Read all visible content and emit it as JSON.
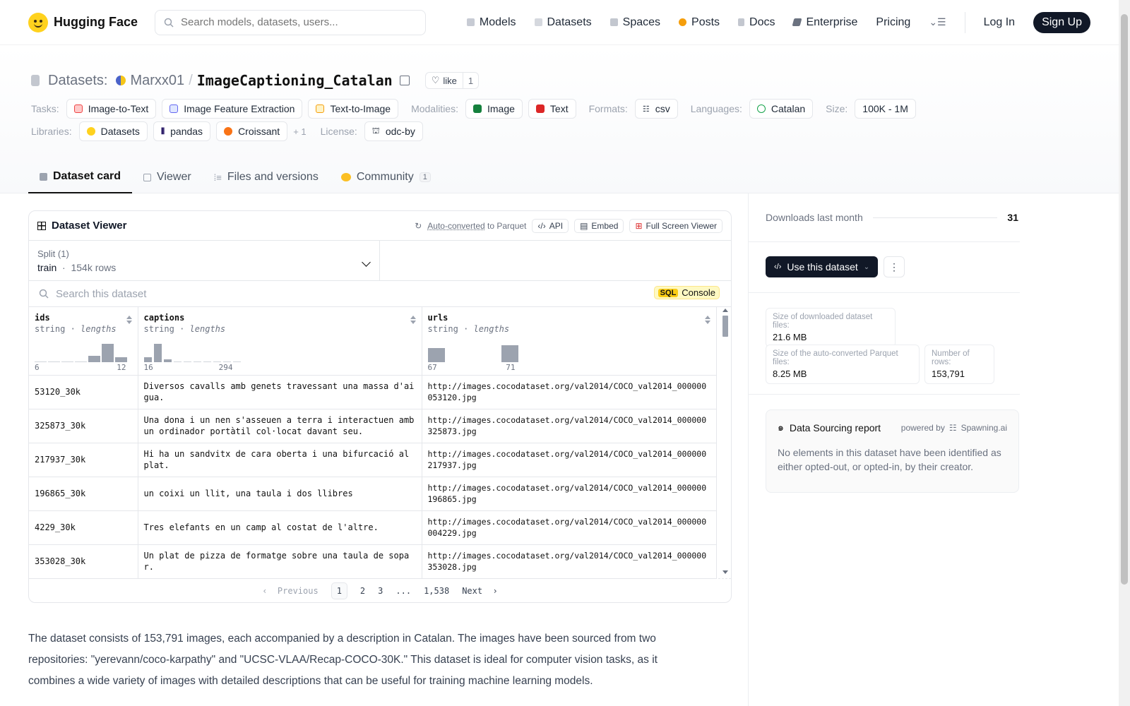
{
  "nav": {
    "brand": "Hugging Face",
    "search_placeholder": "Search models, datasets, users...",
    "links": [
      "Models",
      "Datasets",
      "Spaces",
      "Posts",
      "Docs",
      "Enterprise",
      "Pricing"
    ],
    "login": "Log In",
    "signup": "Sign Up"
  },
  "header": {
    "section": "Datasets:",
    "owner": "Marxx01",
    "separator": "/",
    "name": "ImageCaptioning_Catalan",
    "like_label": "like",
    "like_count": "1",
    "tasks_label": "Tasks:",
    "tasks": [
      "Image-to-Text",
      "Image Feature Extraction",
      "Text-to-Image"
    ],
    "modalities_label": "Modalities:",
    "modalities": [
      "Image",
      "Text"
    ],
    "formats_label": "Formats:",
    "formats": [
      "csv"
    ],
    "languages_label": "Languages:",
    "languages": [
      "Catalan"
    ],
    "size_label": "Size:",
    "size": "100K - 1M",
    "libraries_label": "Libraries:",
    "libraries": [
      "Datasets",
      "pandas",
      "Croissant"
    ],
    "libraries_more": "+ 1",
    "license_label": "License:",
    "license": "odc-by"
  },
  "tabs": [
    {
      "label": "Dataset card"
    },
    {
      "label": "Viewer"
    },
    {
      "label": "Files and versions"
    },
    {
      "label": "Community",
      "badge": "1"
    }
  ],
  "viewer": {
    "title": "Dataset Viewer",
    "auto_converted": "Auto-converted",
    "to_parquet": "to Parquet",
    "api": "API",
    "embed": "Embed",
    "full_screen": "Full Screen Viewer",
    "split_label": "Split (1)",
    "split_name": "train",
    "split_rows": "154k rows",
    "search_placeholder": "Search this dataset",
    "sql": "SQL",
    "console": "Console",
    "columns": [
      {
        "name": "ids",
        "type": "string",
        "stat": "lengths",
        "min": "6",
        "max": "12"
      },
      {
        "name": "captions",
        "type": "string",
        "stat": "lengths",
        "min": "16",
        "max": "294"
      },
      {
        "name": "urls",
        "type": "string",
        "stat": "lengths",
        "min": "67",
        "max": "71"
      }
    ],
    "rows": [
      [
        "53120_30k",
        "Diversos cavalls amb genets travessant una massa d'aigua.",
        "http://images.cocodataset.org/val2014/COCO_val2014_000000053120.jpg"
      ],
      [
        "325873_30k",
        "Una dona i un nen s'asseuen a terra i interactuen amb un ordinador portàtil col·locat davant seu.",
        "http://images.cocodataset.org/val2014/COCO_val2014_000000325873.jpg"
      ],
      [
        "217937_30k",
        "Hi ha un sandvitx de cara oberta i una bifurcació al plat.",
        "http://images.cocodataset.org/val2014/COCO_val2014_000000217937.jpg"
      ],
      [
        "196865_30k",
        "un coixi un llit, una taula i dos llibres",
        "http://images.cocodataset.org/val2014/COCO_val2014_000000196865.jpg"
      ],
      [
        "4229_30k",
        "Tres elefants en un camp al costat de l'altre.",
        "http://images.cocodataset.org/val2014/COCO_val2014_000000004229.jpg"
      ],
      [
        "353028_30k",
        "Un plat de pizza de formatge sobre una taula de sopar.",
        "http://images.cocodataset.org/val2014/COCO_val2014_000000353028.jpg"
      ]
    ],
    "pager": {
      "prev": "Previous",
      "pages": [
        "1",
        "2",
        "3",
        "...",
        "1,538"
      ],
      "next": "Next"
    }
  },
  "description": "The dataset consists of 153,791 images, each accompanied by a description in Catalan. The images have been sourced from two repositories: \"yerevann/coco-karpathy\" and \"UCSC-VLAA/Recap-COCO-30K.\" This dataset is ideal for computer vision tasks, as it combines a wide variety of images with detailed descriptions that can be useful for training machine learning models.",
  "sidebar": {
    "downloads_label": "Downloads last month",
    "downloads": "31",
    "use_dataset": "Use this dataset",
    "download_size_label": "Size of downloaded dataset files:",
    "download_size": "21.6 MB",
    "parquet_size_label": "Size of the auto-converted Parquet files:",
    "parquet_size": "8.25 MB",
    "num_rows_label": "Number of rows:",
    "num_rows": "153,791",
    "report_title": "Data Sourcing report",
    "powered_by": "powered by",
    "spawning": "Spawning.ai",
    "report_text": "No elements in this dataset have been identified as either opted-out, or opted-in, by their creator."
  },
  "colors": {
    "accent": "#111827",
    "brand_yellow": "#ffd21e",
    "sql_yellow": "#facc15"
  }
}
